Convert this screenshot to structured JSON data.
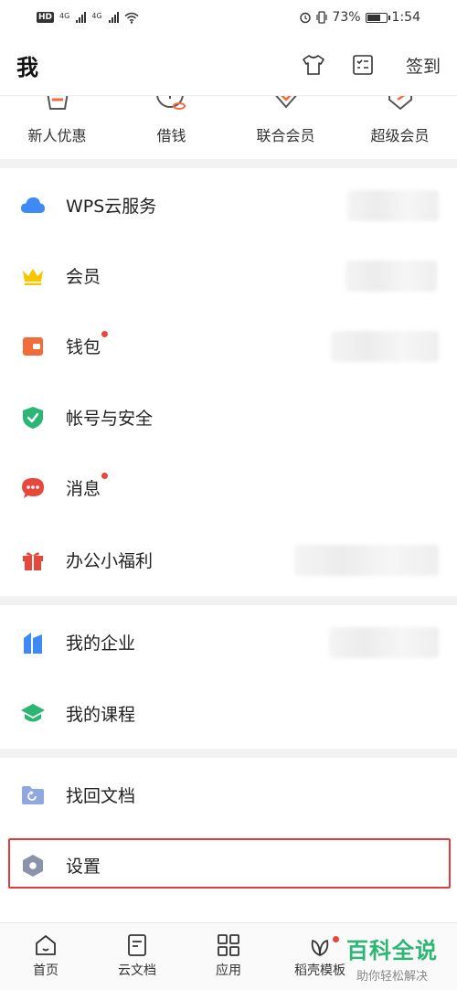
{
  "status_bar": {
    "network_badge": "HD",
    "signal1_label": "4G",
    "signal2_label": "4G",
    "battery_percent": "73%",
    "time": "1:54"
  },
  "header": {
    "title": "我",
    "checkin_label": "签到"
  },
  "quick_actions": [
    {
      "label": "新人优惠",
      "icon": "gift-box-icon"
    },
    {
      "label": "借钱",
      "icon": "coin-icon"
    },
    {
      "label": "联合会员",
      "icon": "heart-badge-icon"
    },
    {
      "label": "超级会员",
      "icon": "shield-badge-icon"
    }
  ],
  "menu_groups": [
    [
      {
        "label": "WPS云服务",
        "icon": "cloud-icon",
        "color": "#3d8af7"
      },
      {
        "label": "会员",
        "icon": "crown-icon",
        "color": "#f7c600"
      },
      {
        "label": "钱包",
        "icon": "wallet-icon",
        "color": "#f26b3a",
        "badge_dot": true
      },
      {
        "label": "帐号与安全",
        "icon": "shield-check-icon",
        "color": "#2bb673"
      },
      {
        "label": "消息",
        "icon": "message-icon",
        "color": "#e8473b",
        "badge_dot": true
      },
      {
        "label": "办公小福利",
        "icon": "gift-icon",
        "color": "#e8473b"
      }
    ],
    [
      {
        "label": "我的企业",
        "icon": "enterprise-icon",
        "color": "#3d8af7"
      },
      {
        "label": "我的课程",
        "icon": "graduation-cap-icon",
        "color": "#2bb673"
      }
    ],
    [
      {
        "label": "找回文档",
        "icon": "folder-recover-icon",
        "color": "#8fa8e0"
      },
      {
        "label": "设置",
        "icon": "settings-hexagon-icon",
        "color": "#8a94a8"
      }
    ]
  ],
  "bottom_nav": [
    {
      "label": "首页",
      "icon": "home-icon"
    },
    {
      "label": "云文档",
      "icon": "cloud-doc-icon"
    },
    {
      "label": "应用",
      "icon": "apps-grid-icon"
    },
    {
      "label": "稻壳模板",
      "icon": "leaf-icon",
      "badge_dot": true
    }
  ],
  "watermark": {
    "title": "百科全说",
    "subtitle": "助你轻松解决"
  }
}
